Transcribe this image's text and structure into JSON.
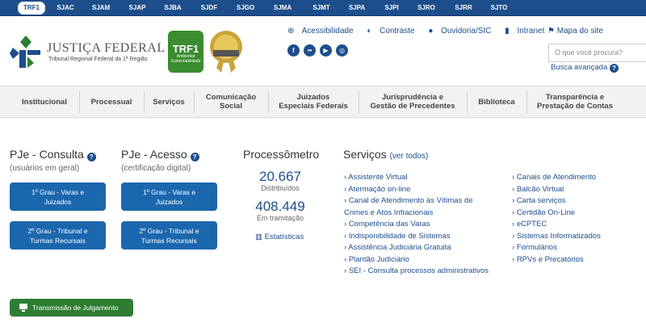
{
  "top_tabs": [
    "TRF1",
    "SJAC",
    "SJAM",
    "SJAP",
    "SJBA",
    "SJDF",
    "SJGO",
    "SJMA",
    "SJMT",
    "SJPA",
    "SJPI",
    "SJRO",
    "SJRR",
    "SJTO"
  ],
  "header": {
    "title": "JUSTIÇA FEDERAL",
    "subtitle": "Tribunal Regional Federal da 1ª Região",
    "seal_green_top": "TRF1",
    "seal_green_bottom": "Ambiental Sustentabilidade",
    "seal_gold_text": "QUALIDADE"
  },
  "tools": {
    "accessibility": "Acessibilidade",
    "contrast": "Contraste",
    "ombudsman": "Ouvidoria/SIC",
    "intranet": "Intranet",
    "sitemap": "Mapa do site",
    "search_placeholder": "O que você procura?",
    "advanced_search": "Busca avançada"
  },
  "social_icons": [
    "facebook-icon",
    "flickr-icon",
    "youtube-icon",
    "instagram-icon"
  ],
  "nav": [
    "Institucional",
    "Processual",
    "Serviços",
    "Comunicação\nSocial",
    "Juizados\nEspeciais Federais",
    "Jurisprudência e\nGestão de Precedentes",
    "Biblioteca",
    "Transparência e\nPrestação de Contas"
  ],
  "pje_consulta": {
    "title": "PJe - Consulta",
    "subtitle": "(usuários em geral)",
    "btn1": "1º Grau - Varas e\nJuizados",
    "btn2": "2º Grau - Tribunal e\nTurmas Recursais"
  },
  "pje_acesso": {
    "title": "PJe - Acesso",
    "subtitle": "(certificação digital)",
    "btn1": "1º Grau - Varas e\nJuizados",
    "btn2": "2º Grau - Tribunal e\nTurmas Recursais"
  },
  "processometro": {
    "title": "Processômetro",
    "distributed_value": "20.667",
    "distributed_label": "Distribuídos",
    "pending_value": "408.449",
    "pending_label": "Em tramitação",
    "stats_link": "Estatísticas"
  },
  "servicos": {
    "title": "Serviços",
    "see_all": "(ver todos)",
    "left": [
      "Assistente Virtual",
      "Atermação on-line",
      "Canal de Atendimento às Vítimas de",
      "Crimes e Atos Infracionais",
      "Competência das Varas",
      "Indisponibilidade de Sistemas",
      "Assistência Judiciária Gratuita",
      "Plantão Judiciário",
      "SEI - Consulta processos administrativos"
    ],
    "right": [
      "Canais de Atendimento",
      "Balcão Virtual",
      "Carta serviços",
      "Certidão On-Line",
      "eCPTEC",
      "Sistemas Informatizados",
      "Formulários",
      "RPVs e Precatórios"
    ]
  },
  "transmission_button": "Transmissão de Julgamento",
  "colors": {
    "brand_blue": "#1d4e8c",
    "button_blue": "#1b67ad",
    "green": "#2e7d32"
  }
}
